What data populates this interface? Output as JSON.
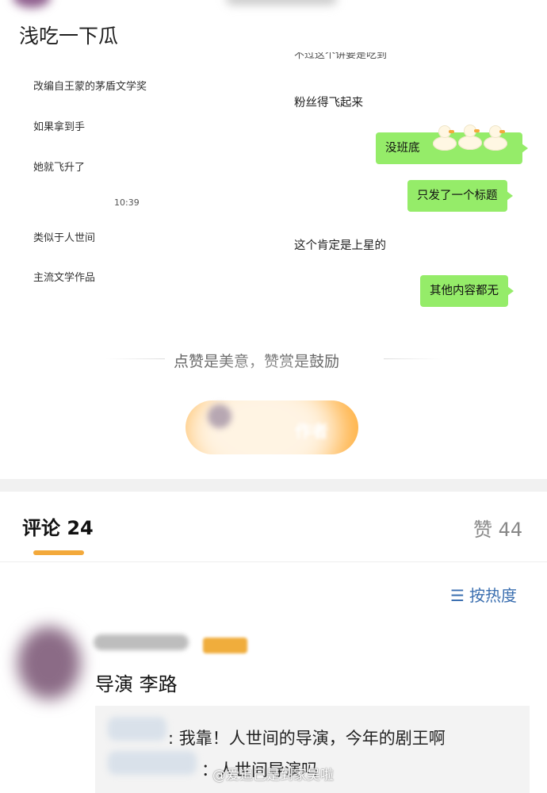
{
  "header": {
    "title": "浅吃一下瓜"
  },
  "chat": {
    "left_messages": [
      "改编自王蒙的茅盾文学奖",
      "如果拿到手",
      "她就飞升了",
      "类似于人世间",
      "主流文学作品"
    ],
    "time": "10:39",
    "right_top_partial": "不过这个讲要是吃到",
    "right_text_1": "粉丝得飞起来",
    "bubble_1": "没班底",
    "bubble_2": "只发了一个标题",
    "right_text_2": "这个肯定是上星的",
    "bubble_3": "其他内容都无"
  },
  "praise": {
    "text": "点赞是美意，赞赏是鼓励"
  },
  "comments": {
    "tab_label": "评论 24",
    "likes_label": "赞 44",
    "sort_label": "按热度",
    "sort_icon": "sort-icon",
    "item": {
      "text": "导演 李路",
      "reply_1": ": 我靠！人世间的导演，今年的剧王啊",
      "reply_2": "：人世间导演吗"
    }
  },
  "watermark": {
    "text": "@爱追己是到家吴啦"
  },
  "colors": {
    "bubble": "#95ec69",
    "accent": "#f3a93b",
    "link": "#3b6fb0"
  }
}
